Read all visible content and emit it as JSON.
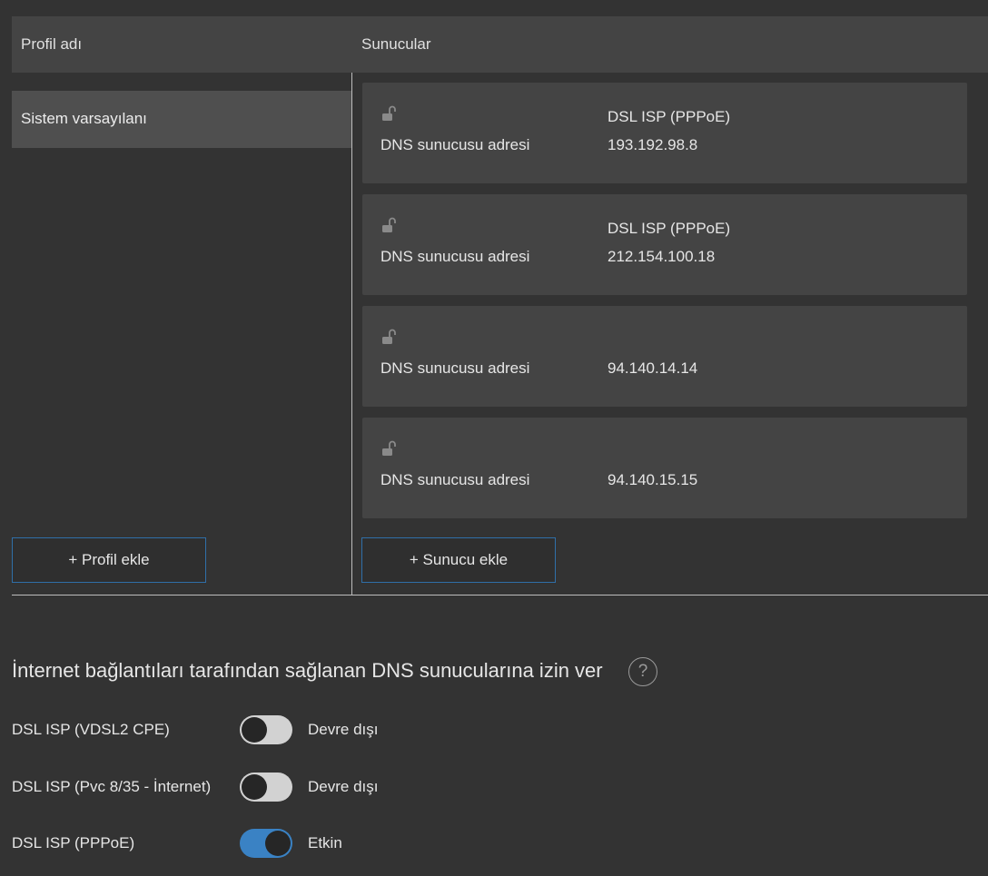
{
  "header": {
    "profile_col": "Profil adı",
    "servers_col": "Sunucular"
  },
  "profiles": [
    {
      "name": "Sistem varsayılanı"
    }
  ],
  "servers": [
    {
      "label": "DNS sunucusu adresi",
      "source": "DSL ISP (PPPoE)",
      "address": "193.192.98.8",
      "icon": "unlock-icon"
    },
    {
      "label": "DNS sunucusu adresi",
      "source": "DSL ISP (PPPoE)",
      "address": "212.154.100.18",
      "icon": "unlock-icon"
    },
    {
      "label": "DNS sunucusu adresi",
      "source": "",
      "address": "94.140.14.14",
      "icon": "unlock-icon"
    },
    {
      "label": "DNS sunucusu adresi",
      "source": "",
      "address": "94.140.15.15",
      "icon": "unlock-icon"
    }
  ],
  "buttons": {
    "add_profile": "+ Profil ekle",
    "add_server": "+ Sunucu ekle"
  },
  "isp_dns": {
    "title": "İnternet bağlantıları tarafından sağlanan DNS sunucularına izin ver",
    "help_icon": "?",
    "connections": [
      {
        "name": "DSL ISP (VDSL2 CPE)",
        "enabled": false,
        "state": "Devre dışı"
      },
      {
        "name": "DSL ISP (Pvc 8/35 - İnternet)",
        "enabled": false,
        "state": "Devre dışı"
      },
      {
        "name": "DSL ISP (PPPoE)",
        "enabled": true,
        "state": "Etkin"
      }
    ]
  },
  "colors": {
    "background": "#333333",
    "panel": "#444444",
    "selected_row": "#4f4f4f",
    "accent": "#3a82c4",
    "button_border": "#2f6fa8"
  }
}
